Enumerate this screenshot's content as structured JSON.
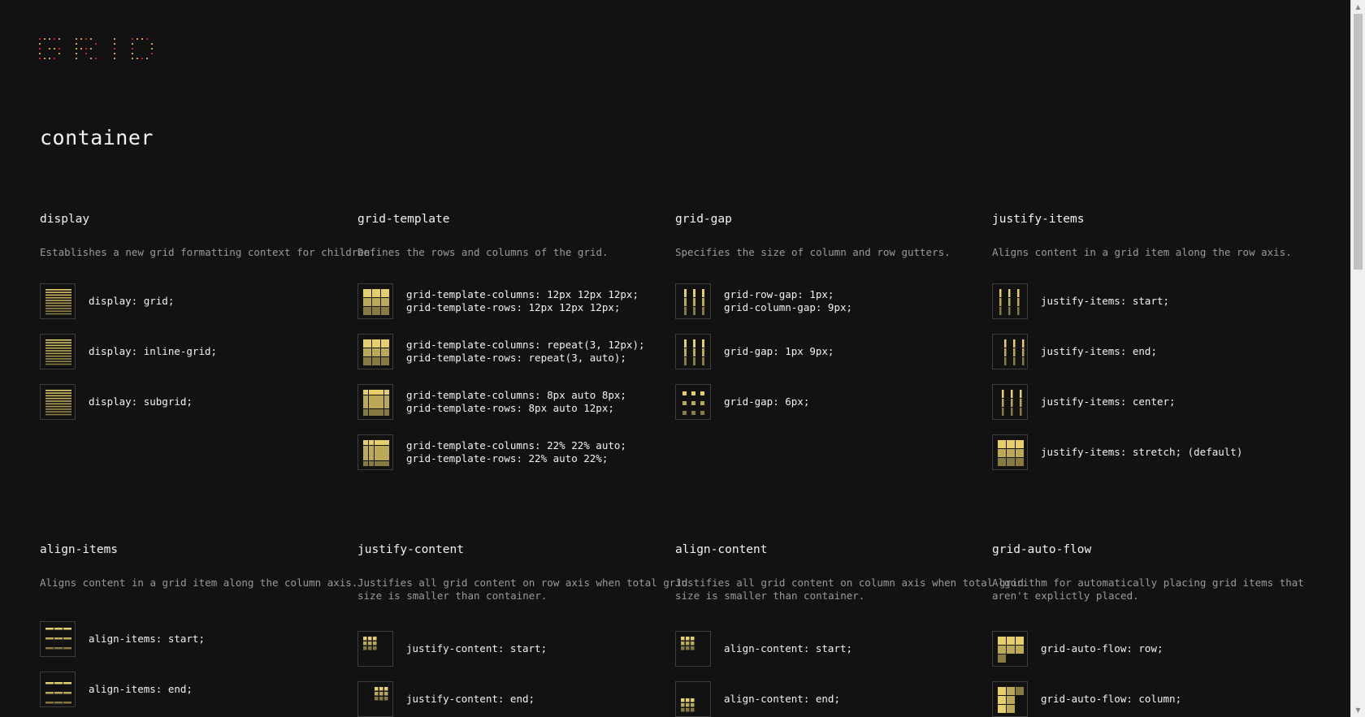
{
  "page_title": "container",
  "colors": {
    "background": "#121212",
    "accent": "#e6cf6a",
    "logo": "#d0164a"
  },
  "sections": [
    {
      "title": "display",
      "desc": "Establishes a new grid formatting context for children.",
      "items": [
        {
          "code": "display: grid;",
          "icon": "horizontal-lines-icon"
        },
        {
          "code": "display: inline-grid;",
          "icon": "horizontal-lines-icon"
        },
        {
          "code": "display: subgrid;",
          "icon": "horizontal-lines-icon"
        }
      ]
    },
    {
      "title": "grid-template",
      "desc": "Defines the rows and columns of the grid.",
      "items": [
        {
          "code": "grid-template-columns: 12px 12px 12px;\ngrid-template-rows: 12px 12px 12px;",
          "icon": "grid-3x3-icon"
        },
        {
          "code": "grid-template-columns: repeat(3, 12px);\ngrid-template-rows: repeat(3, auto);",
          "icon": "grid-3x3-icon"
        },
        {
          "code": "grid-template-columns: 8px auto 8px;\ngrid-template-rows: 8px auto 12px;",
          "icon": "grid-center-large-icon"
        },
        {
          "code": "grid-template-columns: 22% 22% auto;\ngrid-template-rows: 22% auto 22%;",
          "icon": "grid-corner-large-icon"
        }
      ]
    },
    {
      "title": "grid-gap",
      "desc": "Specifies the size of column and row gutters.",
      "items": [
        {
          "code": "grid-row-gap: 1px;\ngrid-column-gap: 9px;",
          "icon": "vertical-bars-icon"
        },
        {
          "code": "grid-gap: 1px 9px;",
          "icon": "vertical-bars-icon"
        },
        {
          "code": "grid-gap: 6px;",
          "icon": "spaced-squares-icon"
        }
      ]
    },
    {
      "title": "justify-items",
      "desc": "Aligns content in a grid item along the row axis.",
      "items": [
        {
          "code": "justify-items: start;",
          "icon": "bars-start-icon"
        },
        {
          "code": "justify-items: end;",
          "icon": "bars-end-icon"
        },
        {
          "code": "justify-items: center;",
          "icon": "bars-center-icon"
        },
        {
          "code": "justify-items: stretch; (default)",
          "icon": "grid-3x3-icon"
        }
      ]
    },
    {
      "title": "align-items",
      "desc": "Aligns content in a grid item along the column axis.",
      "items": [
        {
          "code": "align-items: start;",
          "icon": "dashes-start-icon"
        },
        {
          "code": "align-items: end;",
          "icon": "dashes-end-icon"
        }
      ]
    },
    {
      "title": "justify-content",
      "desc": "Justifies all grid content on row axis when total grid\nsize is smaller than container.",
      "items": [
        {
          "code": "justify-content: start;",
          "icon": "small-grid-start-icon"
        },
        {
          "code": "justify-content: end;",
          "icon": "small-grid-end-icon"
        }
      ]
    },
    {
      "title": "align-content",
      "desc": "Justifies all grid content on column axis when total grid\nsize is smaller than container.",
      "items": [
        {
          "code": "align-content: start;",
          "icon": "small-grid-top-icon"
        },
        {
          "code": "align-content: end;",
          "icon": "small-grid-bottom-icon"
        }
      ]
    },
    {
      "title": "grid-auto-flow",
      "desc": "Algorithm for automatically placing grid items that\naren't explictly placed.",
      "items": [
        {
          "code": "grid-auto-flow: row;",
          "icon": "auto-flow-row-icon"
        },
        {
          "code": "grid-auto-flow: column;",
          "icon": "auto-flow-column-icon"
        }
      ]
    }
  ]
}
